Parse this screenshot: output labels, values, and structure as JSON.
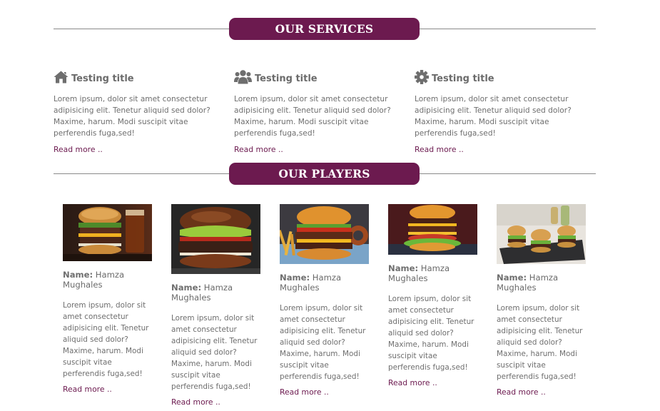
{
  "services_header": {
    "title": "OUR SERVICES"
  },
  "services": [
    {
      "icon": "home-icon",
      "title": "Testing title",
      "text": "Lorem ipsum, dolor sit amet consectetur adipisicing elit. Tenetur aliquid sed dolor? Maxime, harum. Modi suscipit vitae perferendis fuga,sed!",
      "link": "Read more .."
    },
    {
      "icon": "users-icon",
      "title": "Testing title",
      "text": "Lorem ipsum, dolor sit amet consectetur adipisicing elit. Tenetur aliquid sed dolor? Maxime, harum. Modi suscipit vitae perferendis fuga,sed!",
      "link": "Read more .."
    },
    {
      "icon": "gear-icon",
      "title": "Testing title",
      "text": "Lorem ipsum, dolor sit amet consectetur adipisicing elit. Tenetur aliquid sed dolor? Maxime, harum. Modi suscipit vitae perferendis fuga,sed!",
      "link": "Read more .."
    }
  ],
  "players_header": {
    "title": "OUR PLAYERS"
  },
  "players": [
    {
      "name_label": "Name:",
      "name": "Hamza Mughales",
      "text": "Lorem ipsum, dolor sit amet consectetur adipisicing elit. Tenetur aliquid sed dolor? Maxime, harum. Modi suscipit vitae perferendis fuga,sed!",
      "link": "Read more .."
    },
    {
      "name_label": "Name:",
      "name": "Hamza Mughales",
      "text": "Lorem ipsum, dolor sit amet consectetur adipisicing elit. Tenetur aliquid sed dolor? Maxime, harum. Modi suscipit vitae perferendis fuga,sed!",
      "link": "Read more .."
    },
    {
      "name_label": "Name:",
      "name": "Hamza Mughales",
      "text": "Lorem ipsum, dolor sit amet consectetur adipisicing elit. Tenetur aliquid sed dolor? Maxime, harum. Modi suscipit vitae perferendis fuga,sed!",
      "link": "Read more .."
    },
    {
      "name_label": "Name:",
      "name": "Hamza Mughales",
      "text": "Lorem ipsum, dolor sit amet consectetur adipisicing elit. Tenetur aliquid sed dolor? Maxime, harum. Modi suscipit vitae perferendis fuga,sed!",
      "link": "Read more .."
    },
    {
      "name_label": "Name:",
      "name": "Hamza Mughales",
      "text": "Lorem ipsum, dolor sit amet consectetur adipisicing elit. Tenetur aliquid sed dolor? Maxime, harum. Modi suscipit vitae perferendis fuga,sed!",
      "link": "Read more .."
    }
  ],
  "colors": {
    "accent": "#6c1a4f",
    "text": "#6b6b6b",
    "rule": "#8a8a8a"
  }
}
